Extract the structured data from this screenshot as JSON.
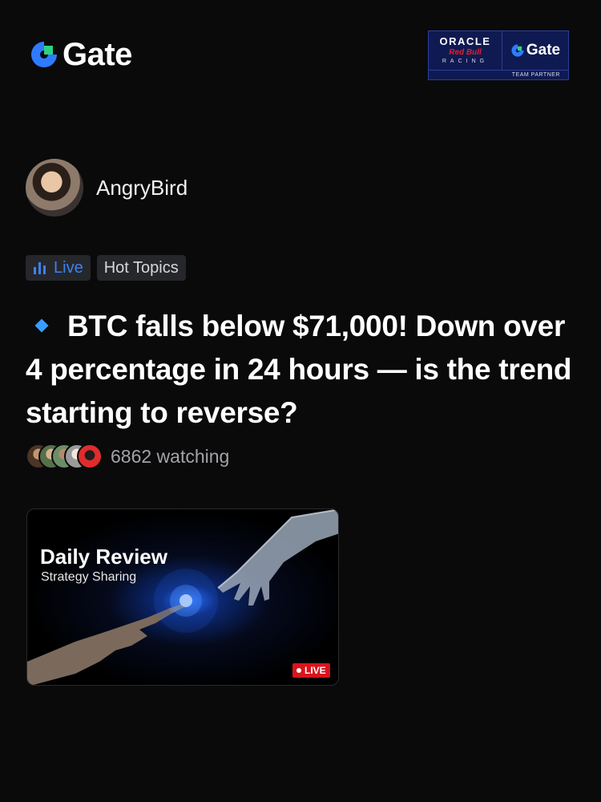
{
  "header": {
    "logo_text": "Gate",
    "partner": {
      "oracle": "ORACLE",
      "redbull": "Red Bull",
      "racing": "RACING",
      "gate": "Gate",
      "team_partner": "TEAM PARTNER"
    }
  },
  "author": {
    "name": "AngryBird"
  },
  "tags": {
    "live": "Live",
    "topic": "Hot Topics"
  },
  "post": {
    "headline": "BTC falls below $71,000! Down over 4 percentage in 24 hours — is the trend starting to reverse?",
    "watching": "6862 watching"
  },
  "video": {
    "title": "Daily Review",
    "subtitle": "Strategy Sharing",
    "badge": "LIVE"
  },
  "colors": {
    "background": "#0a0a0b",
    "accent_blue": "#3b82f6",
    "live_red": "#d8141c",
    "logo_green": "#2bd27e"
  }
}
